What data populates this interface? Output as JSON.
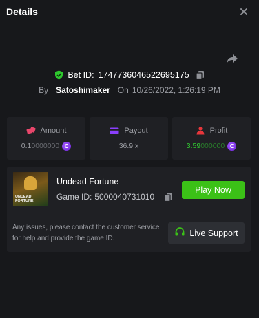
{
  "header": {
    "title": "Details"
  },
  "bet": {
    "id_label": "Bet ID:",
    "id": "1747736046522695175"
  },
  "by": {
    "by_label": "By",
    "user": "Satoshimaker",
    "on_label": "On",
    "datetime": "10/26/2022, 1:26:19 PM"
  },
  "stats": {
    "amount": {
      "label": "Amount",
      "value_main": "0.1",
      "value_tail": "0000000",
      "icon": "dice-icon"
    },
    "payout": {
      "label": "Payout",
      "value": "36.9 x",
      "icon": "card-icon"
    },
    "profit": {
      "label": "Profit",
      "value_main": "3.59",
      "value_tail": "000000",
      "icon": "people-icon"
    }
  },
  "game": {
    "name": "Undead Fortune",
    "id_label": "Game ID:",
    "id": "5000040731010",
    "thumb_line1": "UNDEAD",
    "thumb_line2": "FORTUNE",
    "play_label": "Play Now"
  },
  "support": {
    "text": "Any issues, please contact the customer service for help and provide the game ID.",
    "button_label": "Live Support"
  },
  "colors": {
    "accent_green": "#3bc117",
    "coin_purple": "#8a3ffc",
    "background": "#17181b",
    "card": "#1f2024"
  }
}
